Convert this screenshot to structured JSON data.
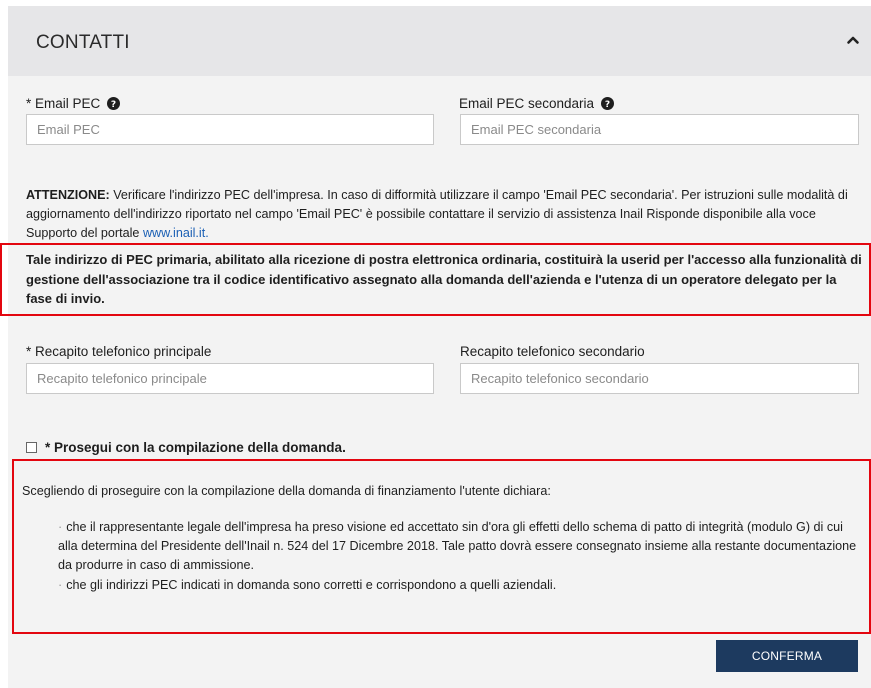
{
  "section": {
    "title": "CONTATTI",
    "collapse_icon": "chevron-up-icon"
  },
  "email": {
    "primary_label": "* Email PEC",
    "primary_placeholder": "Email PEC",
    "secondary_label": "Email PEC secondaria",
    "secondary_placeholder": "Email PEC secondaria",
    "help_icon": "question-circle-icon"
  },
  "attention": {
    "prefix": "ATTENZIONE:",
    "text": " Verificare l'indirizzo PEC dell'impresa. In caso di difformità utilizzare il campo 'Email PEC secondaria'. Per istruzioni sulle modalità di aggiornamento dell'indirizzo riportato nel campo 'Email PEC' è possibile contattare il servizio di assistenza Inail Risponde disponibile alla voce Supporto del portale ",
    "link_text": "www.inail.it."
  },
  "pec_notice": "Tale indirizzo di PEC primaria, abilitato alla ricezione di postra elettronica ordinaria, costituirà la userid per l'accesso alla funzionalità di gestione dell'associazione tra il codice identificativo assegnato alla domanda dell'azienda e l'utenza di un operatore delegato per la fase di invio.",
  "phone": {
    "primary_label": "* Recapito telefonico principale",
    "primary_placeholder": "Recapito telefonico principale",
    "secondary_label": "Recapito telefonico secondario",
    "secondary_placeholder": "Recapito telefonico secondario"
  },
  "continue_checkbox": {
    "label": "* Prosegui con la compilazione della domanda.",
    "checked": false
  },
  "declaration": {
    "intro": "Scegliendo di proseguire con la compilazione della domanda di finanziamento l'utente dichiara:",
    "bullets": [
      "che il rappresentante legale dell'impresa ha preso visione ed accettato sin d'ora gli effetti dello schema di patto di integrità (modulo G) di cui alla determina del Presidente dell'Inail n. 524 del 17 Dicembre 2018. Tale patto dovrà essere consegnato insieme alla restante documentazione da produrre in caso di ammissione.",
      "che gli indirizzi PEC indicati in domanda sono corretti e corrispondono a quelli aziendali."
    ]
  },
  "confirm_button": "CONFERMA",
  "colors": {
    "highlight_border": "#e3060f",
    "button_bg": "#1d3a5f",
    "link": "#1a5fb4"
  }
}
